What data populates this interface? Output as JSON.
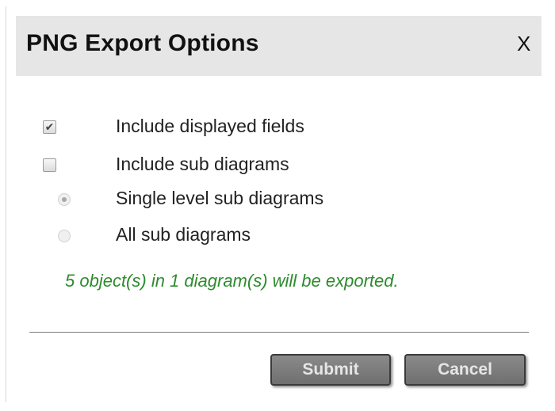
{
  "dialog": {
    "title": "PNG Export Options",
    "close_label": "X"
  },
  "options": [
    {
      "label": "Include displayed fields",
      "type": "checkbox",
      "checked": true
    },
    {
      "label": "Include sub diagrams",
      "type": "checkbox",
      "checked": false
    },
    {
      "label": "Single level sub diagrams",
      "type": "radio",
      "selected": true,
      "disabled": true
    },
    {
      "label": "All sub diagrams",
      "type": "radio",
      "selected": false,
      "disabled": true
    }
  ],
  "status_message": "5 object(s) in 1 diagram(s) will be exported.",
  "buttons": {
    "submit_label": "Submit",
    "cancel_label": "Cancel"
  },
  "colors": {
    "titlebar_bg": "#e6e6e6",
    "status_text": "#2e8b2e",
    "button_bg": "#7d7d7d"
  },
  "icons": {
    "checkmark": "checkmark-icon",
    "close": "close-icon"
  }
}
